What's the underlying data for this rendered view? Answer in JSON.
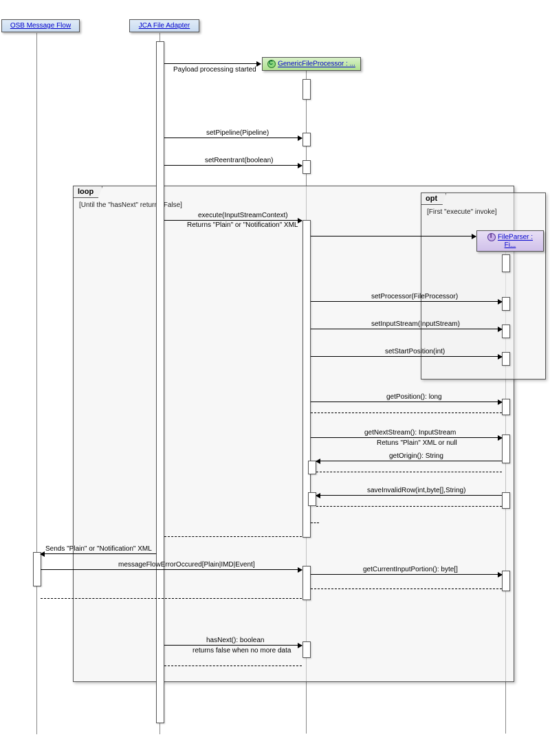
{
  "lifelines": {
    "osb": {
      "label": "OSB Message Flow"
    },
    "jca": {
      "label": "JCA File Adapter"
    },
    "gfp": {
      "label": "GenericFileProcessor : ..."
    },
    "fp": {
      "label": "FileParser : Fi..."
    }
  },
  "fragments": {
    "loop": {
      "name": "loop",
      "guard": "[Until the \"hasNext\" returns False]"
    },
    "opt": {
      "name": "opt",
      "guard": "[First \"execute\" invoke]"
    }
  },
  "messages": {
    "m1": "Payload processing started",
    "m2": "setPipeline(Pipeline)",
    "m3": "setReentrant(boolean)",
    "m4": "execute(InputStreamContext)",
    "m4r": "Returns \"Plain\" or \"Notification\" XML",
    "m5": "setProcessor(FileProcessor)",
    "m6": "setInputStream(InputStream)",
    "m7": "setStartPosition(int)",
    "m8": "getPosition(): long",
    "m9": "getNextStream(): InputStream",
    "m9r": "Retuns \"Plain\" XML or null",
    "m10": "getOrigin(): String",
    "m11": "saveInvalidRow(int,byte[],String)",
    "m12": "Sends \"Plain\" or \"Notification\" XML",
    "m13": "messageFlowErrorOccured[Plain|IMD|Event]",
    "m14": "getCurrentInputPortion(): byte[]",
    "m15": "hasNext(): boolean",
    "m15r": "returns false when no more data"
  }
}
